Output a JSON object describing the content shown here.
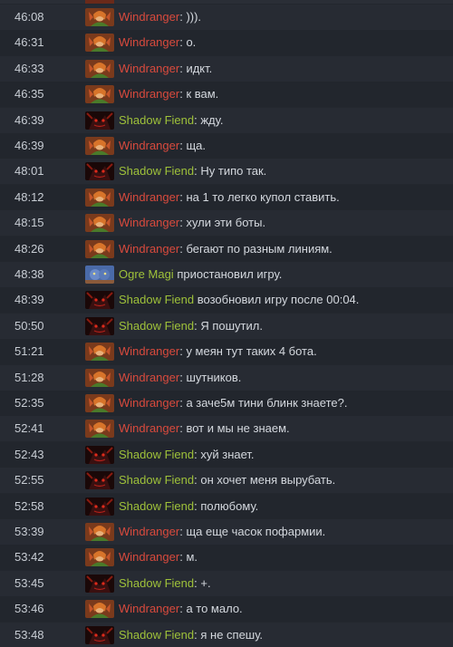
{
  "colors": {
    "Windranger": "#d94a3d",
    "Shadow Fiend": "#9fc23a",
    "Ogre Magi": "#9fc23a"
  },
  "avatar_icons": {
    "Windranger": "windranger-avatar-icon",
    "Shadow Fiend": "shadow-fiend-avatar-icon",
    "Ogre Magi": "ogre-magi-avatar-icon"
  },
  "messages": [
    {
      "time": "46:08",
      "hero": "Windranger",
      "sep": ": ",
      "text": ")))."
    },
    {
      "time": "46:31",
      "hero": "Windranger",
      "sep": ": ",
      "text": "о."
    },
    {
      "time": "46:33",
      "hero": "Windranger",
      "sep": ": ",
      "text": "идкт."
    },
    {
      "time": "46:35",
      "hero": "Windranger",
      "sep": ": ",
      "text": "к вам."
    },
    {
      "time": "46:39",
      "hero": "Shadow Fiend",
      "sep": ": ",
      "text": "жду."
    },
    {
      "time": "46:39",
      "hero": "Windranger",
      "sep": ": ",
      "text": "ща."
    },
    {
      "time": "48:01",
      "hero": "Shadow Fiend",
      "sep": ": ",
      "text": "Ну типо так."
    },
    {
      "time": "48:12",
      "hero": "Windranger",
      "sep": ": ",
      "text": "на 1 то легко купол ставить."
    },
    {
      "time": "48:15",
      "hero": "Windranger",
      "sep": ": ",
      "text": "хули эти боты."
    },
    {
      "time": "48:26",
      "hero": "Windranger",
      "sep": ": ",
      "text": "бегают по разным линиям."
    },
    {
      "time": "48:38",
      "hero": "Ogre Magi",
      "sep": " ",
      "text": "приостановил игру."
    },
    {
      "time": "48:39",
      "hero": "Shadow Fiend",
      "sep": " ",
      "text": "возобновил игру после 00:04."
    },
    {
      "time": "50:50",
      "hero": "Shadow Fiend",
      "sep": ": ",
      "text": "Я пошутил."
    },
    {
      "time": "51:21",
      "hero": "Windranger",
      "sep": ": ",
      "text": "у меян тут таких 4 бота."
    },
    {
      "time": "51:28",
      "hero": "Windranger",
      "sep": ": ",
      "text": "шутников."
    },
    {
      "time": "52:35",
      "hero": "Windranger",
      "sep": ": ",
      "text": "а заче5м тини блинк знаете?."
    },
    {
      "time": "52:41",
      "hero": "Windranger",
      "sep": ": ",
      "text": "вот и мы не знаем."
    },
    {
      "time": "52:43",
      "hero": "Shadow Fiend",
      "sep": ": ",
      "text": "хуй знает."
    },
    {
      "time": "52:55",
      "hero": "Shadow Fiend",
      "sep": ": ",
      "text": "он хочет меня вырубать."
    },
    {
      "time": "52:58",
      "hero": "Shadow Fiend",
      "sep": ": ",
      "text": "полюбому."
    },
    {
      "time": "53:39",
      "hero": "Windranger",
      "sep": ": ",
      "text": "ща еще часок пофармии."
    },
    {
      "time": "53:42",
      "hero": "Windranger",
      "sep": ": ",
      "text": "м."
    },
    {
      "time": "53:45",
      "hero": "Shadow Fiend",
      "sep": ": ",
      "text": "+."
    },
    {
      "time": "53:46",
      "hero": "Windranger",
      "sep": ": ",
      "text": "а то мало."
    },
    {
      "time": "53:48",
      "hero": "Shadow Fiend",
      "sep": ": ",
      "text": "я не спешу."
    }
  ]
}
